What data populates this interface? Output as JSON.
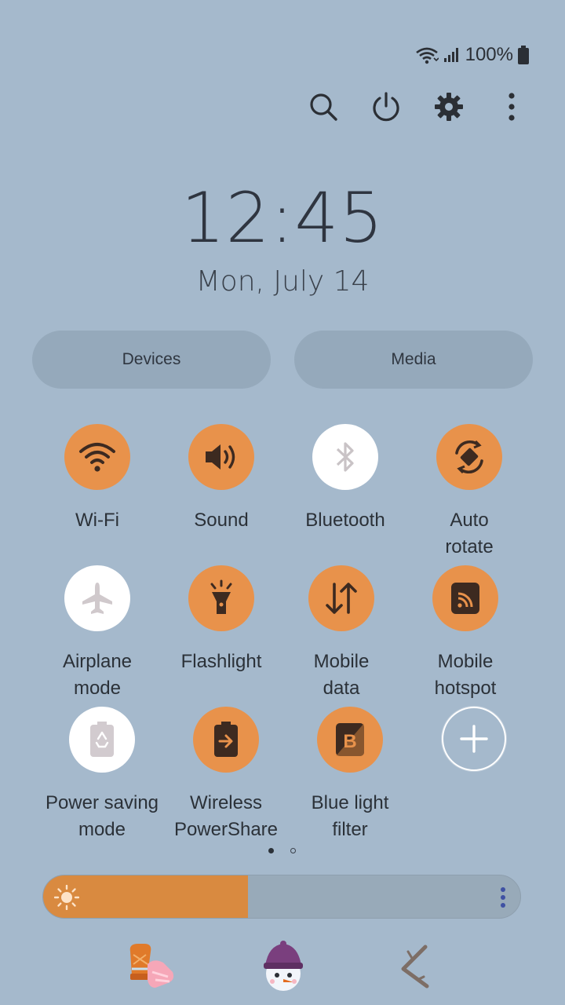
{
  "status_bar": {
    "battery": "100%"
  },
  "header_actions": [
    {
      "icon": "search-icon"
    },
    {
      "icon": "power-icon"
    },
    {
      "icon": "settings-gear-icon"
    },
    {
      "icon": "more-vert-icon"
    }
  ],
  "clock": {
    "time": "12:45",
    "date": "Mon, July 14"
  },
  "buttons": {
    "devices": "Devices",
    "media": "Media"
  },
  "tiles": [
    {
      "label": "Wi-Fi",
      "state": "on",
      "icon": "wifi-icon"
    },
    {
      "label": "Sound",
      "state": "on",
      "icon": "sound-icon"
    },
    {
      "label": "Bluetooth",
      "state": "off",
      "icon": "bluetooth-icon"
    },
    {
      "label": "Auto\nrotate",
      "state": "on",
      "icon": "auto-rotate-icon"
    },
    {
      "label": "Airplane\nmode",
      "state": "off",
      "icon": "airplane-icon"
    },
    {
      "label": "Flashlight",
      "state": "on",
      "icon": "flashlight-icon"
    },
    {
      "label": "Mobile\ndata",
      "state": "on",
      "icon": "mobile-data-icon"
    },
    {
      "label": "Mobile\nhotspot",
      "state": "on",
      "icon": "hotspot-icon"
    },
    {
      "label": "Power saving\nmode",
      "state": "off",
      "icon": "power-saving-icon"
    },
    {
      "label": "Wireless\nPowerShare",
      "state": "on",
      "icon": "wireless-powershare-icon"
    },
    {
      "label": "Blue light\nfilter",
      "state": "on",
      "icon": "blue-light-filter-icon"
    }
  ],
  "pager": {
    "pages": 2,
    "current": 1
  },
  "brightness": {
    "level": 0.43
  },
  "colors": {
    "accent": "#e8924b",
    "background": "#a5b9cc",
    "tile_off": "#ffffff"
  }
}
